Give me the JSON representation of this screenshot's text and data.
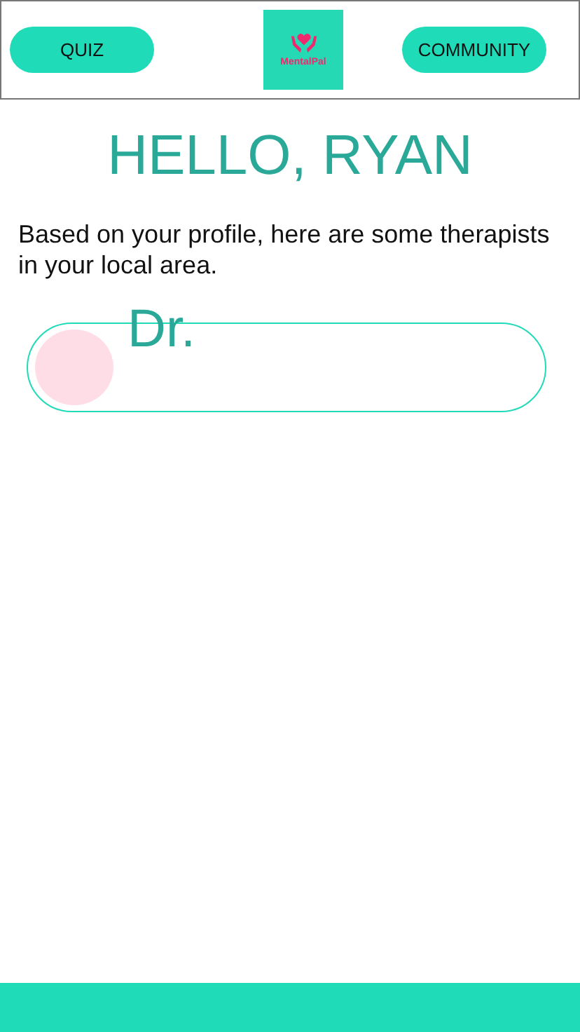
{
  "header": {
    "left_button": "QUIZ",
    "logo_text": "MentalPal",
    "right_button": "COMMUNITY"
  },
  "greeting": "HELLO, RYAN",
  "intro": "Based on your profile, here are some therapists in your local area.",
  "therapists": [
    {
      "name": "Dr."
    }
  ]
}
